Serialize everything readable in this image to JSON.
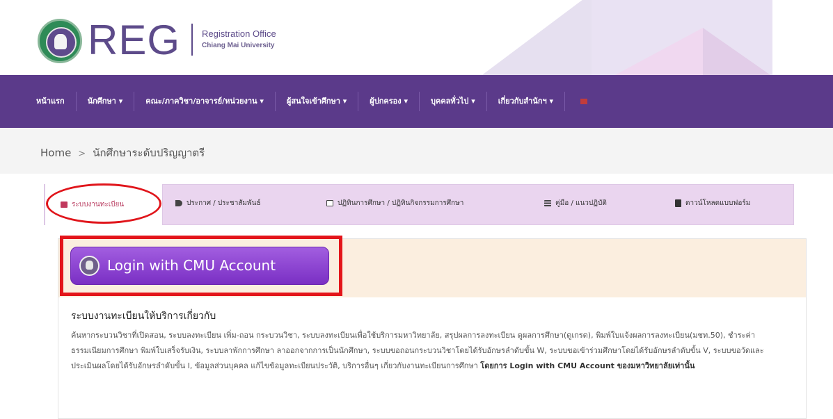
{
  "header": {
    "logo_text": "REG",
    "logo_sub1": "Registration Office",
    "logo_sub2": "Chiang Mai University"
  },
  "nav": {
    "items": [
      "หน้าแรก",
      "นักศึกษา ▾",
      "คณะ/ภาควิชา/อาจารย์/หน่วยงาน ▾",
      "ผู้สนใจเข้าศึกษา ▾",
      "ผู้ปกครอง ▾",
      "บุคคลทั่วไป ▾",
      "เกี่ยวกับสำนักฯ ▾"
    ]
  },
  "breadcrumb": {
    "home": "Home",
    "separator": ">",
    "current": "นักศึกษาระดับปริญญาตรี"
  },
  "tabs": [
    {
      "label": "ระบบงานทะเบียน",
      "icon": "list-icon"
    },
    {
      "label": "ประกาศ / ประชาสัมพันธ์",
      "icon": "megaphone-icon"
    },
    {
      "label": "ปฏิทินการศึกษา / ปฏิทินกิจกรรมการศึกษา",
      "icon": "calendar-icon"
    },
    {
      "label": "คู่มือ / แนวปฏิบัติ",
      "icon": "list-icon"
    },
    {
      "label": "ดาวน์โหลดแบบฟอร์ม",
      "icon": "file-icon"
    }
  ],
  "login": {
    "label": "Login with CMU Account"
  },
  "section": {
    "title": "ระบบงานทะเบียนให้บริการเกี่ยวกับ",
    "description": "ค้นหากระบวนวิชาที่เปิดสอน, ระบบลงทะเบียน เพิ่ม-ถอน กระบวนวิชา, ระบบลงทะเบียนเพื่อใช้บริการมหาวิทยาลัย, สรุปผลการลงทะเบียน ดูผลการศึกษา(ดูเกรด), พิมพ์ใบแจ้งผลการลงทะเบียน(มชท.50), ชำระค่าธรรมเนียมการศึกษา พิมพ์ใบเสร็จรับเงิน, ระบบลาพักการศึกษา ลาออกจากการเป็นนักศึกษา, ระบบขอถอนกระบวนวิชาโดยได้รับอักษรลำดับขั้น W, ระบบขอเข้าร่วมศึกษาโดยได้รับอักษรลำดับขั้น V, ระบบขอวัดและประเมินผลโดยได้รับอักษรลำดับขั้น I, ข้อมูลส่วนบุคคล แก้ไขข้อมูลทะเบียนประวัติ, บริการอื่นๆ เกี่ยวกับงานทะเบียนการศึกษา",
    "emphasis": "โดยการ Login with CMU Account ของมหาวิทยาลัยเท่านั้น"
  },
  "colors": {
    "nav_bg": "#5b3a8a",
    "tab_bar_bg": "#ead5ef",
    "login_button": "#8a44d4",
    "highlight_red": "#e3151a"
  }
}
